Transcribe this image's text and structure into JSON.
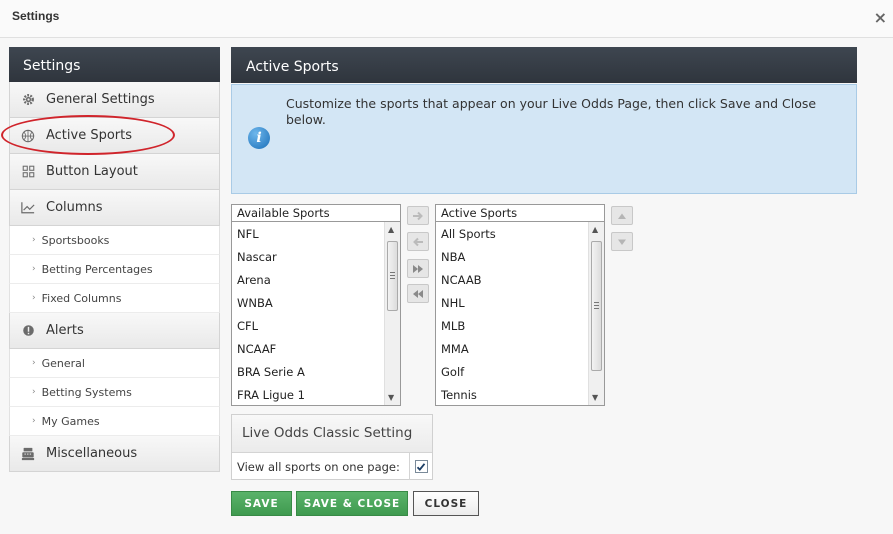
{
  "window": {
    "title": "Settings",
    "close_glyph": "×"
  },
  "sidebar": {
    "header": "Settings",
    "items": [
      {
        "label": "General Settings",
        "icon": "gear-icon"
      },
      {
        "label": "Active Sports",
        "icon": "basketball-icon"
      },
      {
        "label": "Button Layout",
        "icon": "grid-icon"
      },
      {
        "label": "Columns",
        "icon": "line-chart-icon"
      },
      {
        "label": "Alerts",
        "icon": "alert-icon"
      },
      {
        "label": "Miscellaneous",
        "icon": "cash-register-icon"
      }
    ],
    "columns_sub": [
      "Sportsbooks",
      "Betting Percentages",
      "Fixed Columns"
    ],
    "alerts_sub": [
      "General",
      "Betting Systems",
      "My Games"
    ],
    "highlight_color": "#d0242b"
  },
  "main": {
    "header": "Active Sports",
    "info_text": "Customize the sports that appear on your Live Odds Page, then click Save and Close below.",
    "available": {
      "header": "Available Sports",
      "items": [
        "NFL",
        "Nascar",
        "Arena",
        "WNBA",
        "CFL",
        "NCAAF",
        "BRA Serie A",
        "FRA Ligue 1"
      ]
    },
    "active": {
      "header": "Active Sports",
      "items": [
        "All Sports",
        "NBA",
        "NCAAB",
        "NHL",
        "MLB",
        "MMA",
        "Golf",
        "Tennis"
      ]
    },
    "classic": {
      "header": "Live Odds Classic Setting",
      "checkbox_label": "View all sports on one page:",
      "checked": true
    },
    "buttons": {
      "save": "SAVE",
      "save_close": "SAVE & CLOSE",
      "close": "CLOSE"
    },
    "colors": {
      "header_bg": "#353c45",
      "info_bg": "#d3e6f5",
      "save_green": "#4aa55a"
    }
  }
}
